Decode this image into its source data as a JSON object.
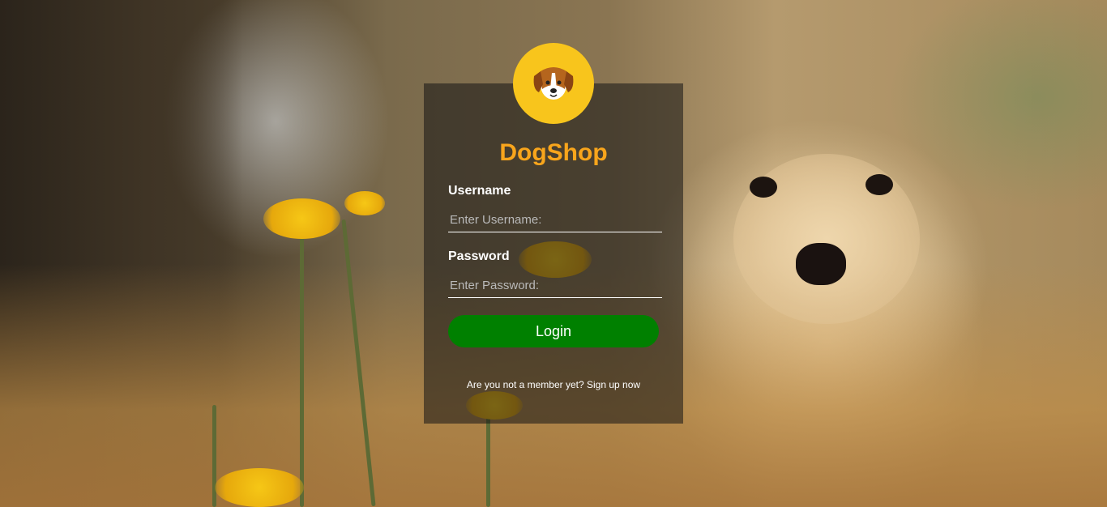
{
  "app": {
    "brand": "DogShop",
    "brand_color": "#f8a51c",
    "logo_bg": "#f8c51c",
    "logo_icon": "dog-face-icon"
  },
  "form": {
    "username_label": "Username",
    "username_placeholder": "Enter Username:",
    "username_value": "",
    "password_label": "Password",
    "password_placeholder": "Enter Password:",
    "password_value": "",
    "login_label": "Login",
    "login_color": "#008000",
    "signup_prefix": "Are you not a member yet?",
    "signup_link": "Sign up now"
  }
}
